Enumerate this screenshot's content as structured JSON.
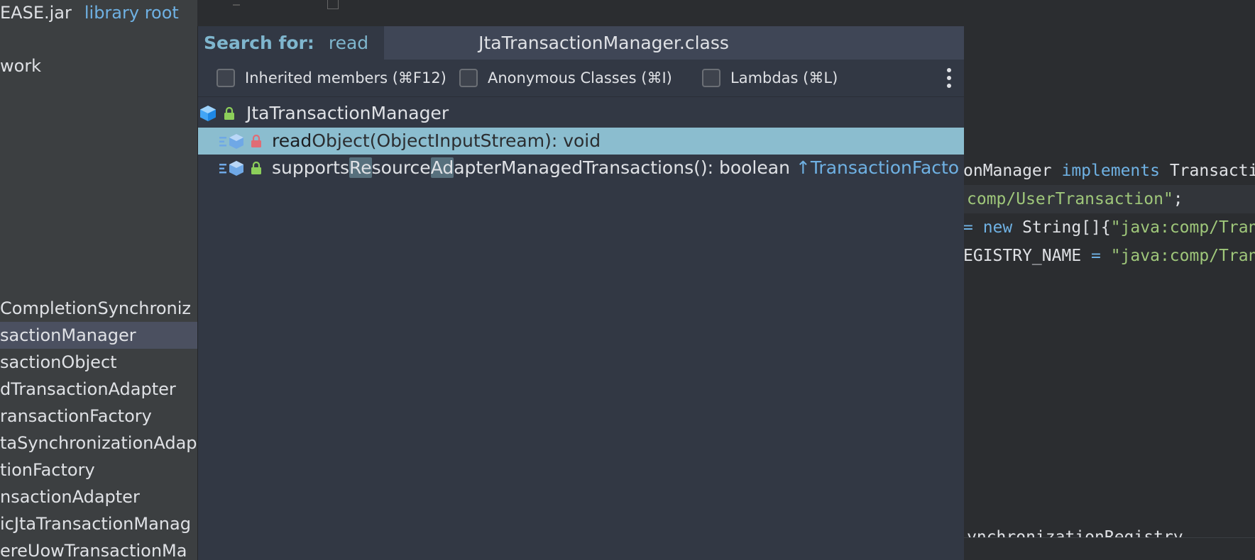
{
  "project_panel": {
    "top_jar": "EASE.jar",
    "top_root_label": "library root",
    "work_label": "work",
    "items": [
      {
        "label": "CompletionSynchroniz",
        "selected": false
      },
      {
        "label": "sactionManager",
        "selected": true
      },
      {
        "label": "sactionObject",
        "selected": false
      },
      {
        "label": "dTransactionAdapter",
        "selected": false
      },
      {
        "label": "ransactionFactory",
        "selected": false
      },
      {
        "label": "taSynchronizationAdap",
        "selected": false
      },
      {
        "label": "tionFactory",
        "selected": false
      },
      {
        "label": "nsactionAdapter",
        "selected": false
      },
      {
        "label": "icJtaTransactionManag",
        "selected": false
      },
      {
        "label": "ereUowTransactionMa",
        "selected": false
      }
    ]
  },
  "popup": {
    "search_label": "Search for:",
    "search_value": "read",
    "title": "JtaTransactionManager.class",
    "options": [
      {
        "label": "Inherited members (⌘F12)",
        "checked": false
      },
      {
        "label": "Anonymous Classes (⌘I)",
        "checked": false
      },
      {
        "label": "Lambdas (⌘L)",
        "checked": false
      }
    ],
    "root_class": "JtaTransactionManager",
    "results": {
      "r1_match": "read",
      "r1_rest": "Object(ObjectInputStream): void",
      "r2_a": "supports",
      "r2_b": "Re",
      "r2_c": "source",
      "r2_d": "Ad",
      "r2_e": "apterManagedTransactions(): boolean",
      "r2_inherited": "↑TransactionFacto"
    }
  },
  "editor": {
    "line1_a": "onManager ",
    "line1_kw": "implements",
    "line1_b": " Transacti",
    "line2_str": "comp/UserTransaction\"",
    "line2_semi": ";",
    "line3_op": "= ",
    "line3_kw": "new",
    "line3_plain": " String[]{",
    "line3_str": "\"java:comp/Tran",
    "line4_plain": "EGISTRY_NAME ",
    "line4_op": "=",
    "line4_str": " \"java:comp/Tran",
    "line5_plain": "ynchronizationRegistry"
  },
  "colors": {
    "selection": "#8bbdcf",
    "accent": "#6fb1e3",
    "string": "#9fc77a",
    "popup_bg": "#323844"
  },
  "icons": [
    "class-cube-icon",
    "lock-icon",
    "method-cube-icon",
    "inherited-arrow-icon",
    "more-vertical-icon"
  ]
}
